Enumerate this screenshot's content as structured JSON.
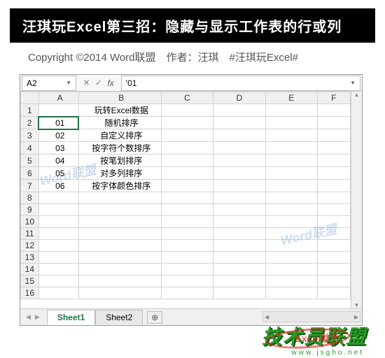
{
  "banner": {
    "title": "汪琪玩Excel第三招：隐藏与显示工作表的行或列"
  },
  "copyright": {
    "text": "Copyright ©2014 Word联盟　作者：汪琪　#汪琪玩Excel#"
  },
  "excel": {
    "name_box": "A2",
    "formula_value": "'01",
    "fx_label": "fx",
    "columns": [
      "A",
      "B",
      "C",
      "D",
      "E",
      "F"
    ],
    "rows": [
      {
        "n": "1",
        "A": "",
        "B": "玩转Excel数据"
      },
      {
        "n": "2",
        "A": "01",
        "B": "随机排序"
      },
      {
        "n": "3",
        "A": "02",
        "B": "自定义排序"
      },
      {
        "n": "4",
        "A": "03",
        "B": "按字符个数排序"
      },
      {
        "n": "5",
        "A": "04",
        "B": "按笔划排序"
      },
      {
        "n": "6",
        "A": "05",
        "B": "对多列排序"
      },
      {
        "n": "7",
        "A": "06",
        "B": "按字体颜色排序"
      },
      {
        "n": "8",
        "A": "",
        "B": ""
      },
      {
        "n": "9",
        "A": "",
        "B": ""
      },
      {
        "n": "10",
        "A": "",
        "B": ""
      },
      {
        "n": "11",
        "A": "",
        "B": ""
      },
      {
        "n": "12",
        "A": "",
        "B": ""
      },
      {
        "n": "13",
        "A": "",
        "B": ""
      },
      {
        "n": "14",
        "A": "",
        "B": ""
      },
      {
        "n": "15",
        "A": "",
        "B": ""
      },
      {
        "n": "16",
        "A": "",
        "B": ""
      }
    ],
    "active_cell": "A2",
    "tabs": {
      "sheet1": "Sheet1",
      "sheet2": "Sheet2",
      "add": "⊕"
    },
    "nav_icons": {
      "prev": "◀",
      "next": "▶"
    }
  },
  "watermarks": {
    "brand": "Word联盟",
    "green": "技术员联盟",
    "green_url": "www.jsgho.net",
    "red_text": "Excel助手"
  }
}
